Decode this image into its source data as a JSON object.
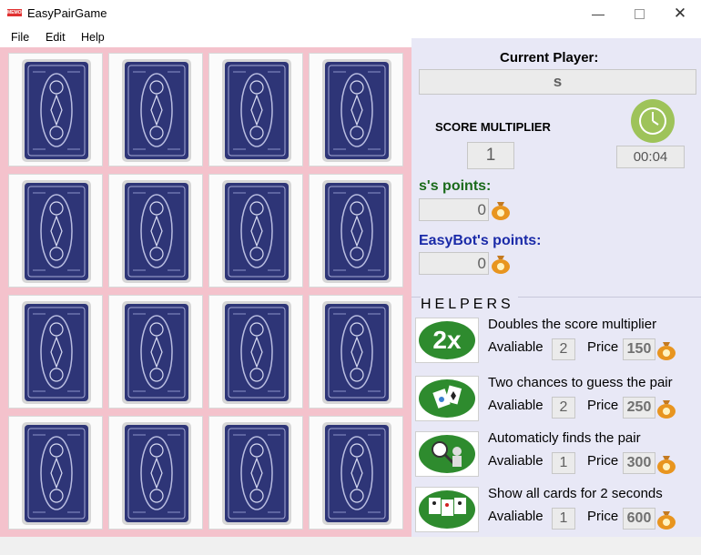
{
  "window": {
    "title": "EasyPairGame",
    "icon_text": "MEMORY"
  },
  "menu": [
    "File",
    "Edit",
    "Help"
  ],
  "board": {
    "rows": 4,
    "cols": 4,
    "card_count": 16,
    "card_back": "blue-bicycle-card-back-icon"
  },
  "panel": {
    "current_player_label": "Current Player:",
    "current_player": "s",
    "score_multiplier_label": "SCORE MULTIPLIER",
    "score_multiplier": "1",
    "timer": "00:04",
    "player_points_label": "s's points:",
    "player_points": "0",
    "bot_points_label": "EasyBot's points:",
    "bot_points": "0",
    "helpers_title": "HELPERS"
  },
  "helpers": [
    {
      "icon": "2x-icon",
      "desc": "Doubles the score multiplier",
      "avail_label": "Avaliable",
      "available": "2",
      "price_label": "Price",
      "price": "150"
    },
    {
      "icon": "two-chances-cards-icon",
      "desc": "Two chances to guess the pair",
      "avail_label": "Avaliable",
      "available": "2",
      "price_label": "Price",
      "price": "250"
    },
    {
      "icon": "auto-find-magnifier-icon",
      "desc": "Automaticly finds the pair",
      "avail_label": "Avaliable",
      "available": "1",
      "price_label": "Price",
      "price": "300"
    },
    {
      "icon": "show-all-cards-icon",
      "desc": "Show all cards for 2 seconds",
      "avail_label": "Avaliable",
      "available": "1",
      "price_label": "Price",
      "price": "600"
    }
  ],
  "colors": {
    "board_bg": "#f4c2cc",
    "panel_bg": "#e8e8f6",
    "card_back": "#2e3577",
    "player_color": "#1a6a1a",
    "bot_color": "#1a2aa8",
    "helper_green": "#2e8b2e",
    "clock_green": "#9ec35a"
  }
}
